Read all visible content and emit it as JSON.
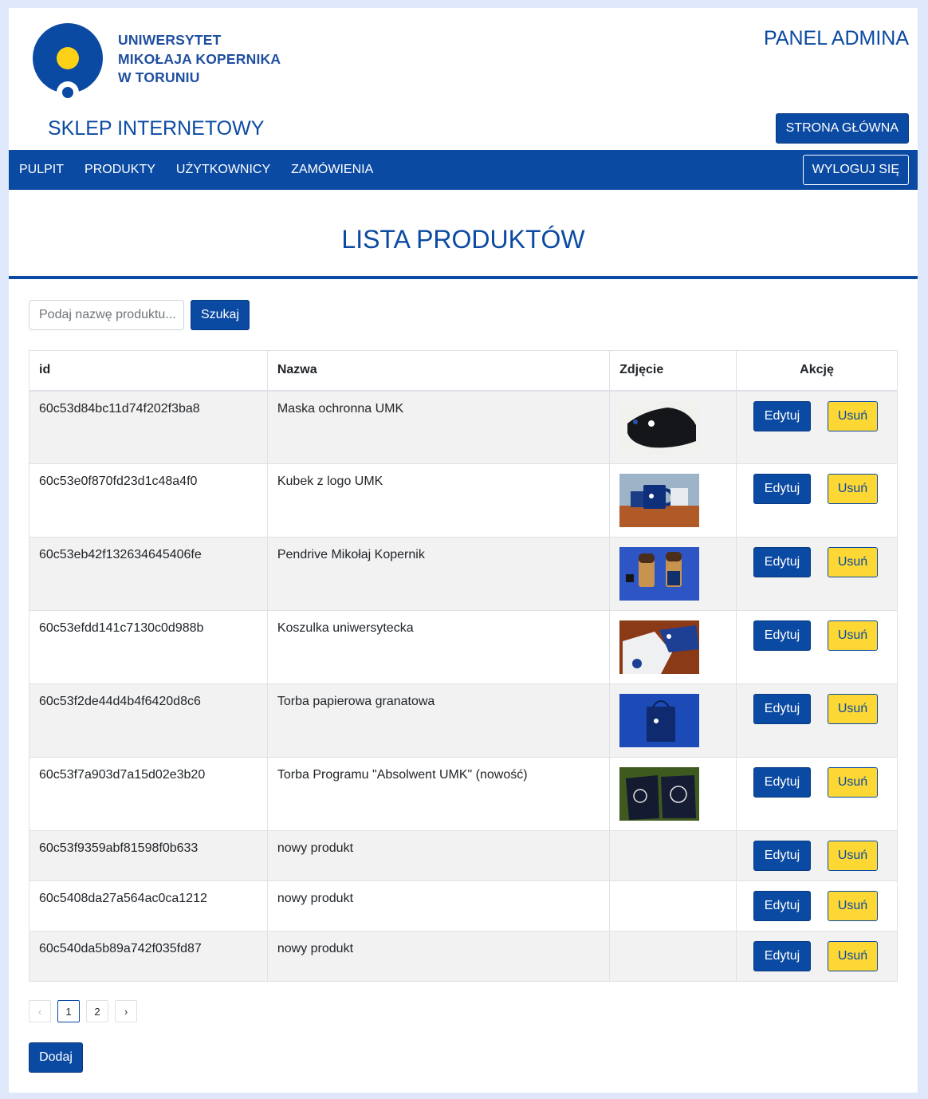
{
  "header": {
    "university_lines": [
      "UNIWERSYTET",
      "MIKOŁAJA KOPERNIKA",
      "W TORUNIU"
    ],
    "panel_title": "PANEL ADMINA",
    "shop_title": "SKLEP INTERNETOWY",
    "home_button": "STRONA GŁÓWNA"
  },
  "nav": {
    "items": [
      "PULPIT",
      "PRODUKTY",
      "UŻYTKOWNICY",
      "ZAMÓWIENIA"
    ],
    "logout": "WYLOGUJ SIĘ"
  },
  "main": {
    "title": "LISTA PRODUKTÓW",
    "search_placeholder": "Podaj nazwę produktu...",
    "search_button": "Szukaj",
    "add_button": "Dodaj"
  },
  "table": {
    "headers": [
      "id",
      "Nazwa",
      "Zdjęcie",
      "Akcję"
    ],
    "edit_label": "Edytuj",
    "delete_label": "Usuń",
    "rows": [
      {
        "id": "60c53d84bc11d74f202f3ba8",
        "name": "Maska ochronna UMK",
        "image": "mask-photo"
      },
      {
        "id": "60c53e0f870fd23d1c48a4f0",
        "name": "Kubek z logo UMK",
        "image": "mug-photo"
      },
      {
        "id": "60c53eb42f132634645406fe",
        "name": "Pendrive Mikołaj Kopernik",
        "image": "pendrive-photo"
      },
      {
        "id": "60c53efdd141c7130c0d988b",
        "name": "Koszulka uniwersytecka",
        "image": "tshirt-photo"
      },
      {
        "id": "60c53f2de44d4b4f6420d8c6",
        "name": "Torba papierowa granatowa",
        "image": "paper-bag-photo"
      },
      {
        "id": "60c53f7a903d7a15d02e3b20",
        "name": "Torba Programu \"Absolwent UMK\" (nowość)",
        "image": "tote-bag-photo"
      },
      {
        "id": "60c53f9359abf81598f0b633",
        "name": "nowy produkt",
        "image": ""
      },
      {
        "id": "60c5408da27a564ac0ca1212",
        "name": "nowy produkt",
        "image": ""
      },
      {
        "id": "60c540da5b89a742f035fd87",
        "name": "nowy produkt",
        "image": ""
      }
    ]
  },
  "pagination": {
    "prev": "‹",
    "pages": [
      "1",
      "2"
    ],
    "next": "›",
    "current": "1"
  },
  "colors": {
    "brand_blue": "#0b4aa2",
    "accent_yellow": "#fdd835",
    "page_background": "#dfe8fb"
  }
}
